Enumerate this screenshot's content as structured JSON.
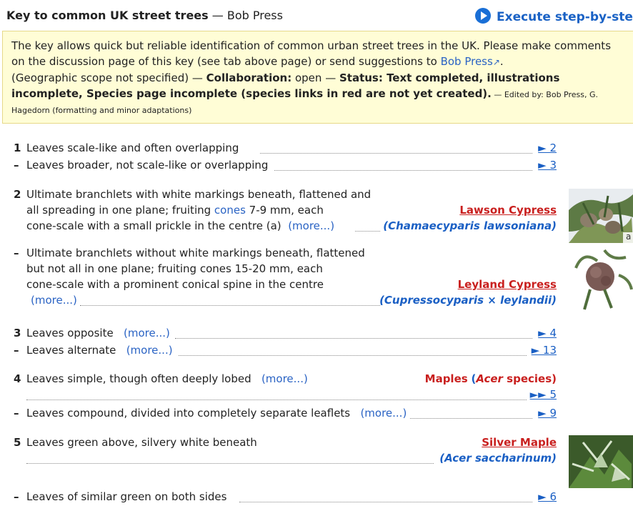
{
  "header": {
    "title_bold": "Key to common UK street trees",
    "title_rest": " — Bob Press",
    "execute_label": "Execute step-by-step"
  },
  "info": {
    "line1": "The key allows quick but reliable identification of common urban street trees in the UK. Please make comments",
    "line2a": "on the discussion page of this key (see tab above page) or send suggestions to ",
    "line2_link": "Bob Press",
    "line2b": ".",
    "scope": "(Geographic scope not specified) — ",
    "collab_label": "Collaboration:",
    "collab_value": " open — ",
    "status_label": "Status: Text completed, illustrations",
    "status_label2": "incomplete, Species page incomplete (species links in red are not yet created).",
    "edited": " — Edited by: Bob Press, G.",
    "edited2": "Hagedorn (formatting and minor adaptations)"
  },
  "more": "(more...)",
  "couplets": [
    {
      "num": "1",
      "text": "Leaves scale-like and often overlapping",
      "goto": "► 2"
    },
    {
      "num": "–",
      "text": "Leaves broader, not scale-like or overlapping",
      "goto": "► 3"
    },
    {
      "num": "2",
      "l1": "Ultimate branchlets with white markings beneath, flattened and",
      "l2a": "all spreading in one plane; fruiting ",
      "l2link": "cones",
      "l2b": " 7-9 mm, each",
      "l3": "cone-scale with a small prickle in the centre (a)",
      "taxon": "Lawson Cypress",
      "sci": "(Chamaecyparis lawsoniana)"
    },
    {
      "num": "–",
      "l1": "Ultimate branchlets without white markings beneath, flattened",
      "l2": "but not all in one plane; fruiting cones 15-20 mm, each",
      "l3": "cone-scale with a prominent conical spine in the centre",
      "taxon": "Leyland Cypress",
      "sci": "(Cupressocyparis × leylandii)"
    },
    {
      "num": "3",
      "text": "Leaves opposite",
      "goto": "► 4"
    },
    {
      "num": "–",
      "text": "Leaves alternate",
      "goto": "► 13"
    },
    {
      "num": "4",
      "text": "Leaves simple, though often deeply lobed",
      "taxon": "Maples",
      "taxon_sci": "Acer",
      "taxon_rest": " species)",
      "goto": "►► 5"
    },
    {
      "num": "–",
      "text": "Leaves compound, divided into completely separate leaflets",
      "goto": "► 9"
    },
    {
      "num": "5",
      "text": "Leaves green above, silvery white beneath",
      "taxon": "Silver Maple",
      "sci": "(Acer saccharinum)"
    },
    {
      "num": "–",
      "text": "Leaves of similar green on both sides",
      "goto": "► 6"
    }
  ],
  "thumb_label_a": "a"
}
